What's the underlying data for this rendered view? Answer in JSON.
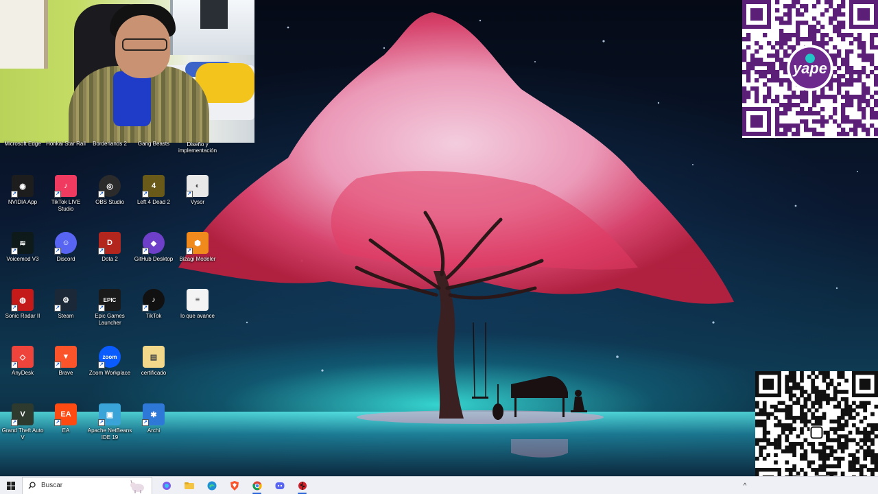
{
  "desktop": {
    "partial_labels": [
      "Microsoft Edge",
      "Honkai Star Rail",
      "Borderlands 2",
      "Gang Beasts",
      "Diseño y implementación"
    ],
    "icons": [
      {
        "label": "NVIDIA App",
        "icon": "nvidia-icon",
        "color": "#1d1d1d"
      },
      {
        "label": "TikTok LIVE Studio",
        "icon": "tiktok-live-icon",
        "color": "#f03a5f"
      },
      {
        "label": "OBS Studio",
        "icon": "obs-icon",
        "color": "#2b2b2b"
      },
      {
        "label": "Left 4 Dead 2",
        "icon": "left4dead-icon",
        "color": "#6a5a1a"
      },
      {
        "label": "Vysor",
        "icon": "vysor-icon",
        "color": "#e8e8e8"
      },
      {
        "label": "Voicemod V3",
        "icon": "voicemod-icon",
        "color": "#0e1a1a"
      },
      {
        "label": "Discord",
        "icon": "discord-icon",
        "color": "#5865f2"
      },
      {
        "label": "Dota 2",
        "icon": "dota2-icon",
        "color": "#b3261e"
      },
      {
        "label": "GitHub Desktop",
        "icon": "github-desktop-icon",
        "color": "#6e40c9"
      },
      {
        "label": "Bizagi Modeler",
        "icon": "bizagi-icon",
        "color": "#f08a1c"
      },
      {
        "label": "Sonic Radar II",
        "icon": "sonic-radar-icon",
        "color": "#c41a1a"
      },
      {
        "label": "Steam",
        "icon": "steam-icon",
        "color": "#1b2838"
      },
      {
        "label": "Epic Games Launcher",
        "icon": "epic-games-icon",
        "color": "#1a1a1a"
      },
      {
        "label": "TikTok",
        "icon": "tiktok-icon",
        "color": "#111111"
      },
      {
        "label": "lo que avance",
        "icon": "text-file-icon",
        "color": "#f4f4f4"
      },
      {
        "label": "AnyDesk",
        "icon": "anydesk-icon",
        "color": "#ef443b"
      },
      {
        "label": "Brave",
        "icon": "brave-icon",
        "color": "#fb542b"
      },
      {
        "label": "Zoom Workplace",
        "icon": "zoom-icon",
        "color": "#0b5cff"
      },
      {
        "label": "certificado",
        "icon": "certificate-file-icon",
        "color": "#f1d88a"
      },
      {
        "label": "Grand Theft Auto V",
        "icon": "gta5-icon",
        "color": "#2f3a2f"
      },
      {
        "label": "EA",
        "icon": "ea-icon",
        "color": "#ff4a11"
      },
      {
        "label": "Apache NetBeans IDE 19",
        "icon": "netbeans-icon",
        "color": "#3aa3d8"
      },
      {
        "label": "Archi",
        "icon": "archi-icon",
        "color": "#2e78d8"
      }
    ]
  },
  "overlays": {
    "qr_top_brand": "yape"
  },
  "taskbar": {
    "search_placeholder": "Buscar",
    "apps": [
      {
        "name": "copilot",
        "icon": "copilot-icon",
        "color": "#7b5cf0"
      },
      {
        "name": "file-explorer",
        "icon": "folder-icon",
        "color": "#f5c542"
      },
      {
        "name": "edge",
        "icon": "edge-icon",
        "color": "#1f8fd6"
      },
      {
        "name": "brave",
        "icon": "brave-icon",
        "color": "#fb542b"
      },
      {
        "name": "chrome",
        "icon": "chrome-icon",
        "color": "#db4437"
      },
      {
        "name": "discord",
        "icon": "discord-icon",
        "color": "#5865f2"
      },
      {
        "name": "other",
        "icon": "ladybug-icon",
        "color": "#d0202a"
      }
    ],
    "tray_chevron": "^"
  }
}
